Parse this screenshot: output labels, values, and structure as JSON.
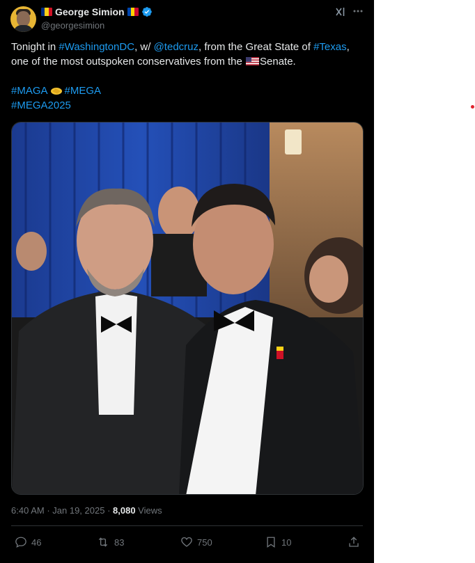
{
  "author": {
    "display_name": "George Simion",
    "handle": "@georgesimion",
    "verified": true,
    "badge_color": "#1d9bf0",
    "flags": [
      "romania-flag",
      "moldova-flag"
    ]
  },
  "tweet": {
    "line1": {
      "t1": "Tonight in ",
      "l1": "#WashingtonDC",
      "t2": ", w/ ",
      "l2": "@tedcruz",
      "t3": ", from the Great State of ",
      "l3": "#Texas",
      "t4": ", one of the most outspoken conservatives from the ",
      "t5": "Senate."
    },
    "hashtags1": {
      "h1": "#MAGA",
      "emoji": "handshake-emoji",
      "h2": "#MEGA"
    },
    "hashtags2": {
      "h1": "#MEGA2025"
    },
    "link_color": "#1d9bf0"
  },
  "meta": {
    "time": "6:40 AM",
    "sep1": " · ",
    "date": "Jan 19, 2025",
    "sep2": " · ",
    "views_count": "8,080",
    "views_label": " Views"
  },
  "actions": {
    "replies": "46",
    "reposts": "83",
    "likes": "750",
    "bookmarks": "10"
  },
  "icons": {
    "grok": "grok-icon",
    "more": "more-icon",
    "reply": "reply-icon",
    "repost": "repost-icon",
    "like": "heart-icon",
    "bookmark": "bookmark-icon",
    "share": "share-icon"
  }
}
